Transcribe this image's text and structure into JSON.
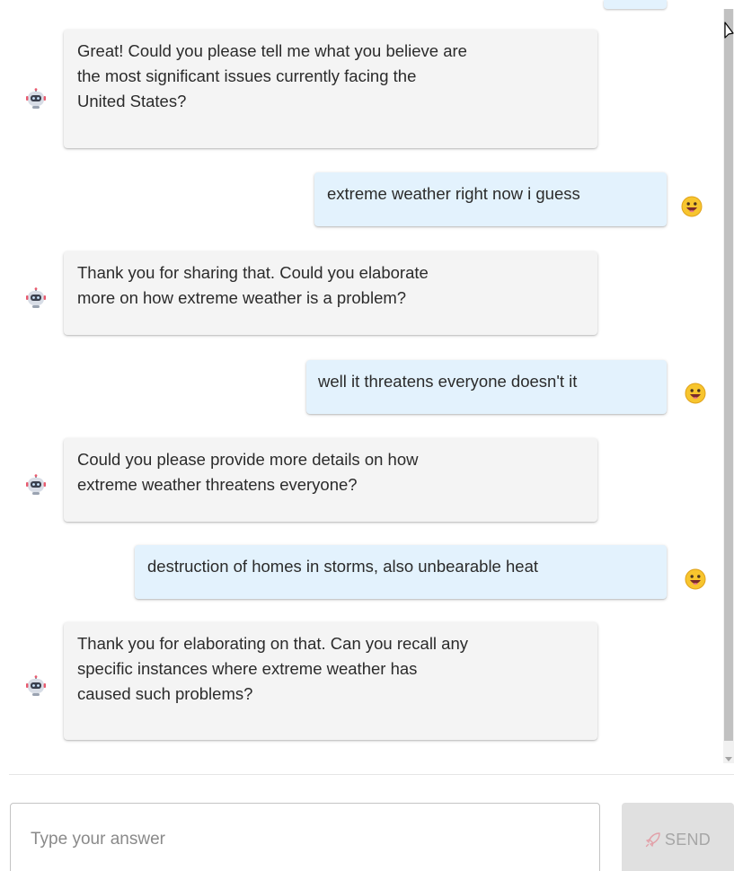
{
  "chat": {
    "messages": [
      {
        "role": "bot",
        "text": "Great! Could you please tell me what you believe are\nthe most significant issues currently facing the\nUnited States?"
      },
      {
        "role": "user",
        "text": "extreme weather right now i guess"
      },
      {
        "role": "bot",
        "text": "Thank you for sharing that. Could you elaborate\nmore on how extreme weather is a problem?"
      },
      {
        "role": "user",
        "text": "well it threatens everyone doesn't it"
      },
      {
        "role": "bot",
        "text": "Could you please provide more details on how\nextreme weather threatens everyone?"
      },
      {
        "role": "user",
        "text": "destruction of homes in storms, also unbearable heat"
      },
      {
        "role": "bot",
        "text": "Thank you for elaborating on that. Can you recall any\nspecific instances where extreme weather has\ncaused such problems?"
      }
    ],
    "bot_avatar_icon": "robot-icon",
    "user_avatar_icon": "smiley-face-icon"
  },
  "composer": {
    "input_placeholder": "Type your answer",
    "input_value": "",
    "send_label": "SEND",
    "send_icon": "rocket-icon"
  },
  "colors": {
    "bot_bubble": "#f4f4f4",
    "user_bubble": "#e3f2fd",
    "send_button_disabled": "#e0e0e0"
  }
}
